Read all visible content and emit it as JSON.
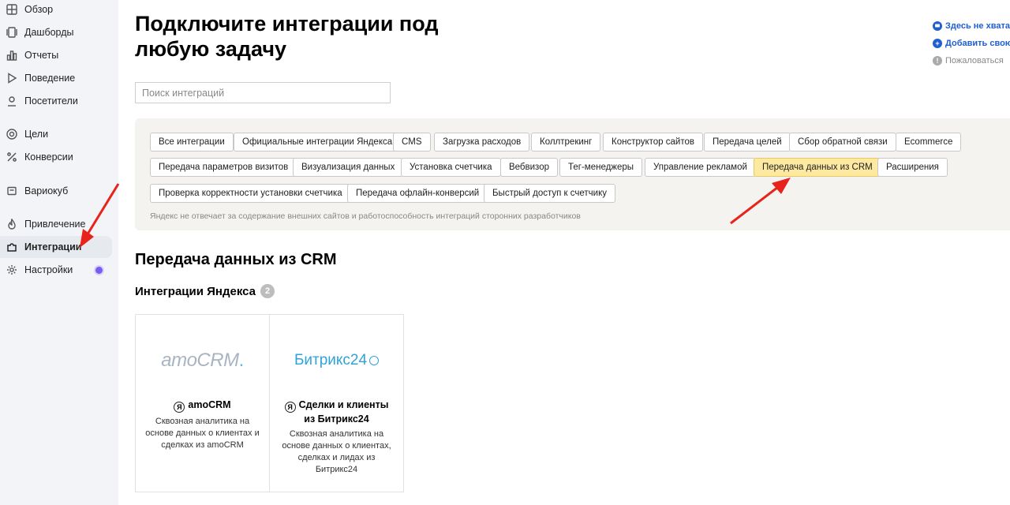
{
  "sidebar": {
    "items": [
      {
        "label": "Обзор",
        "icon": "grid-icon"
      },
      {
        "label": "Дашборды",
        "icon": "dashboards-icon"
      },
      {
        "label": "Отчеты",
        "icon": "bar-chart-icon"
      },
      {
        "label": "Поведение",
        "icon": "play-icon"
      },
      {
        "label": "Посетители",
        "icon": "user-icon"
      },
      {
        "label": "Цели",
        "icon": "target-icon"
      },
      {
        "label": "Конверсии",
        "icon": "percent-icon"
      },
      {
        "label": "Вариокуб",
        "icon": "cube-icon"
      },
      {
        "label": "Привлечение",
        "icon": "flame-icon"
      },
      {
        "label": "Интеграции",
        "icon": "puzzle-icon"
      },
      {
        "label": "Настройки",
        "icon": "gear-icon"
      }
    ]
  },
  "page": {
    "title": "Подключите интеграции под любую задачу",
    "search_placeholder": "Поиск интеграций"
  },
  "right_links": [
    {
      "label": "Здесь не хватает",
      "icon": "chat-icon"
    },
    {
      "label": "Добавить свою",
      "icon": "plus-circle-icon"
    },
    {
      "label": "Пожаловаться",
      "icon": "warning-icon"
    }
  ],
  "filters": {
    "chips": [
      "Все интеграции",
      "Официальные интеграции Яндекса",
      "CMS",
      "Загрузка расходов",
      "Коллтрекинг",
      "Конструктор сайтов",
      "Передача целей",
      "Сбор обратной связи",
      "Ecommerce",
      "Передача параметров визитов",
      "Визуализация данных",
      "Установка счетчика",
      "Вебвизор",
      "Тег-менеджеры",
      "Управление рекламой",
      "Передача данных из CRM",
      "Расширения",
      "Проверка корректности установки счетчика",
      "Передача офлайн-конверсий",
      "Быстрый доступ к счетчику"
    ],
    "selected": "Передача данных из CRM",
    "disclaimer": "Яндекс не отвечает за содержание внешних сайтов и работоспособность интеграций сторонних разработчиков"
  },
  "section": {
    "title": "Передача данных из CRM",
    "subsection_title": "Интеграции Яндекса",
    "count": "2"
  },
  "cards": [
    {
      "logo_text": "amoCRM",
      "logo_dot": ".",
      "title": "amoCRM",
      "description": "Сквозная аналитика на основе данных о клиентах и сделках из amoCRM"
    },
    {
      "logo_text": "Битрикс24",
      "title": "Сделки и клиенты из Битрикс24",
      "description": "Сквозная аналитика на основе данных о клиентах, сделках и лидах из Битрикс24"
    }
  ],
  "colors": {
    "sidebar_bg": "#f2f4f7",
    "link_blue": "#1f5fcf",
    "selected_chip": "#fde9a0",
    "arrow_red": "#e8231b"
  }
}
